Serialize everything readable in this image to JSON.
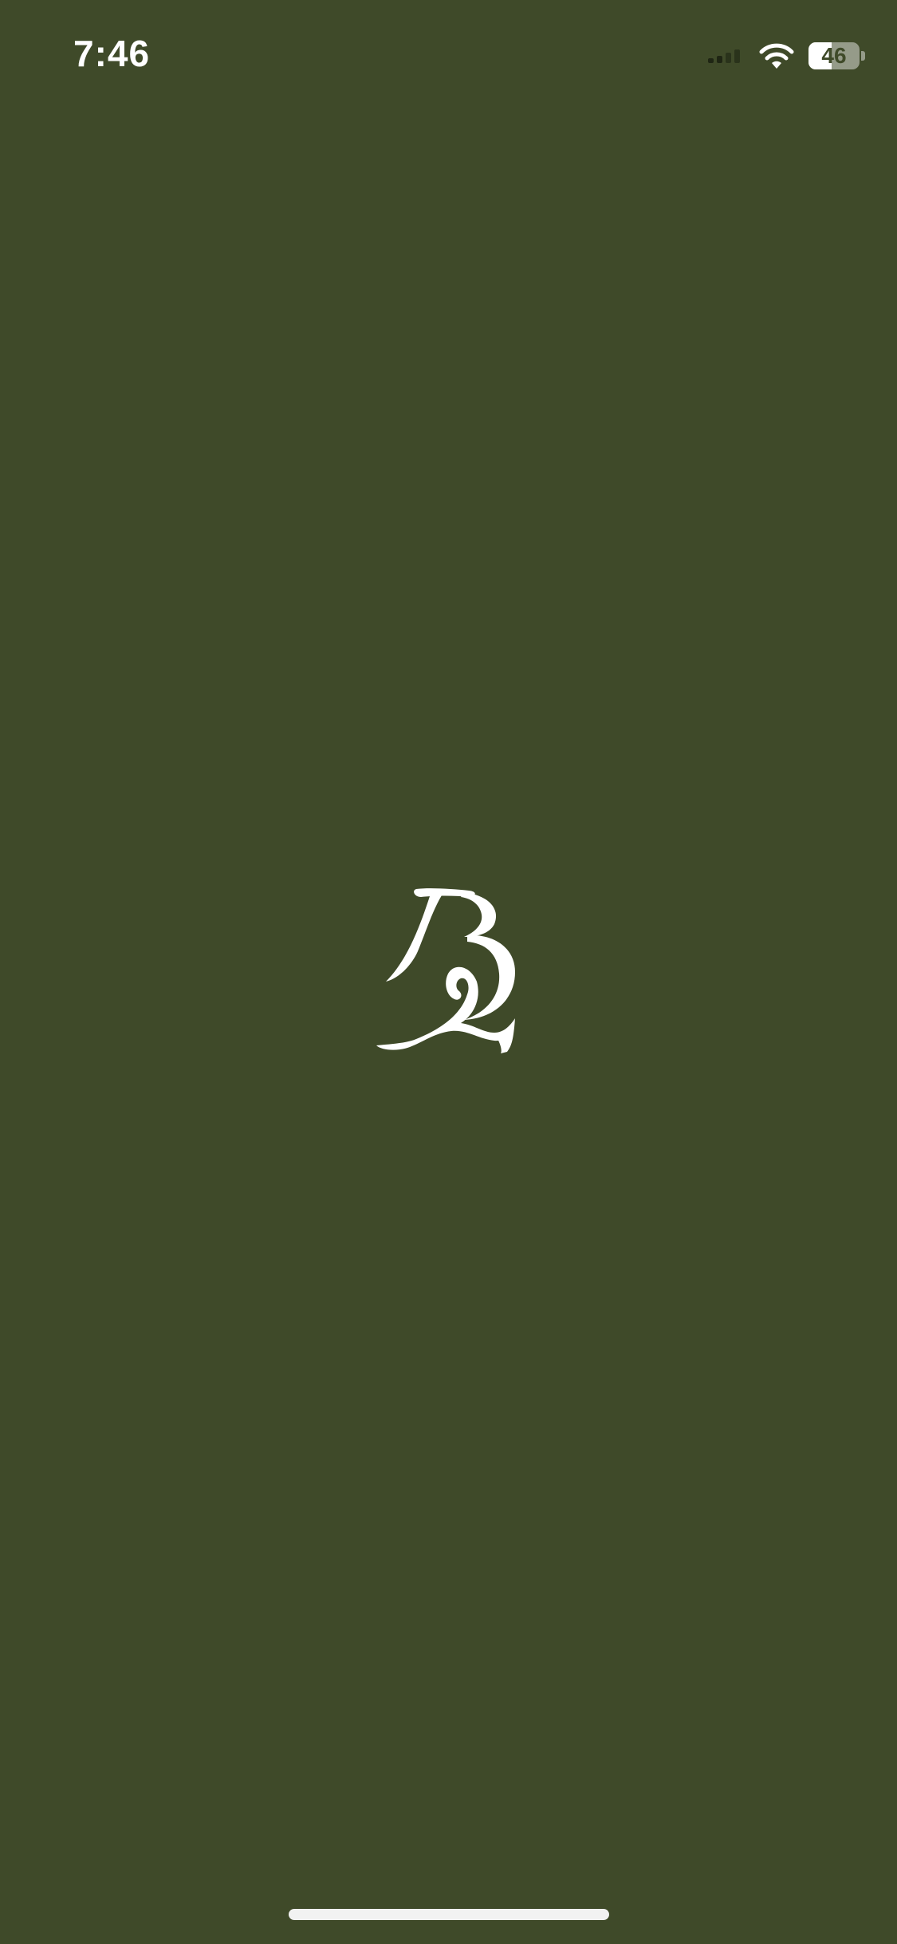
{
  "status_bar": {
    "time": "7:46",
    "battery_level": "46",
    "battery_fraction": 0.46,
    "signal_bars_active": 2,
    "signal_bars_total": 4
  },
  "splash": {
    "logo_icon": "bl-monogram-icon",
    "logo_letters": "BL"
  },
  "colors": {
    "background": "#3f4a29",
    "foreground": "#ffffff"
  }
}
